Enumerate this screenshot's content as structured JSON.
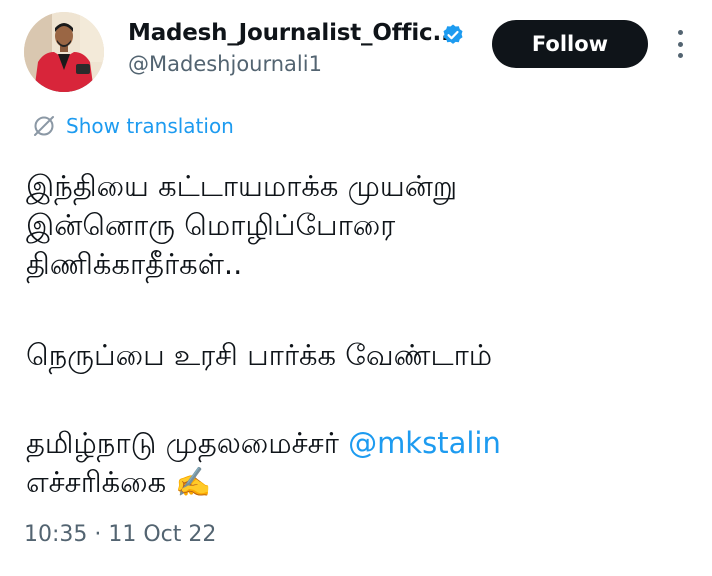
{
  "author": {
    "display_name": "Madesh_Journalist_Offic...",
    "handle": "@Madeshjournali1",
    "verified": true,
    "avatar_icon": "profile-photo"
  },
  "follow_label": "Follow",
  "more_icon": "vertical-ellipsis-icon",
  "translation_label": "Show translation",
  "tweet": {
    "lines_block1": [
      "இந்தியை கட்டாயமாக்க முயன்று",
      "இன்னொரு மொழிப்போரை",
      "திணிக்காதீர்கள்.."
    ],
    "line_block2": "நெருப்பை உரசி பார்க்க வேண்டாம்",
    "block3_prefix": "தமிழ்நாடு முதலமைச்சர் ",
    "mention": "@mkstalin",
    "block3_last": "எச்சரிக்கை ✍️"
  },
  "timestamp": "10:35 · 11 Oct 22",
  "colors": {
    "link": "#1d9bf0",
    "text": "#0f1419",
    "muted": "#536471",
    "button_bg": "#0f1419"
  }
}
